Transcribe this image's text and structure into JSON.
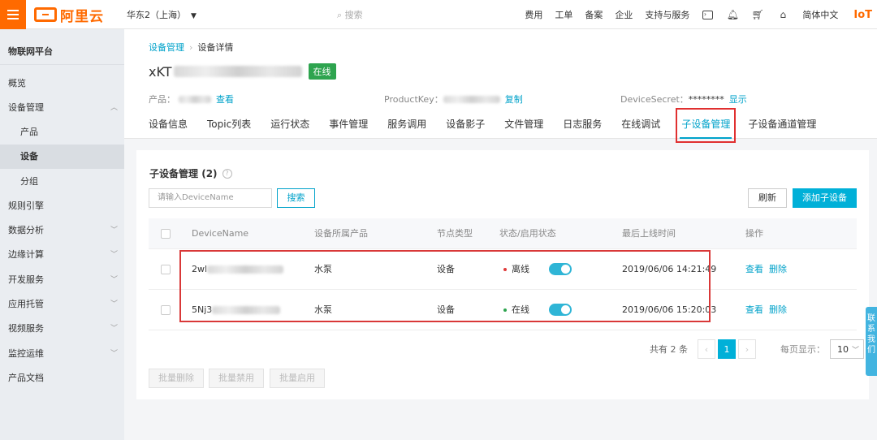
{
  "topbar": {
    "logo_text": "阿里云",
    "region": "华东2（上海）",
    "search_placeholder": "搜索",
    "links": [
      "费用",
      "工单",
      "备案",
      "企业",
      "支持与服务"
    ],
    "language": "简体中文",
    "iot_label": "IoT",
    "accent_color": "#ff6a00"
  },
  "sidebar": {
    "title": "物联网平台",
    "items": [
      {
        "label": "概览"
      },
      {
        "label": "设备管理"
      },
      {
        "label": "产品"
      },
      {
        "label": "设备"
      },
      {
        "label": "分组"
      },
      {
        "label": "规则引擎"
      },
      {
        "label": "数据分析"
      },
      {
        "label": "边缘计算"
      },
      {
        "label": "开发服务"
      },
      {
        "label": "应用托管"
      },
      {
        "label": "视频服务"
      },
      {
        "label": "监控运维"
      },
      {
        "label": "产品文档"
      }
    ]
  },
  "breadcrumb": {
    "parent": "设备管理",
    "current": "设备详情"
  },
  "device": {
    "name_prefix": "xKT",
    "status_badge": "在线",
    "product_label": "产品：",
    "product_link": "查看",
    "productkey_label": "ProductKey：",
    "productkey_link": "复制",
    "secret_label": "DeviceSecret：",
    "secret_value": "********",
    "secret_link": "显示"
  },
  "tabs": [
    "设备信息",
    "Topic列表",
    "运行状态",
    "事件管理",
    "服务调用",
    "设备影子",
    "文件管理",
    "日志服务",
    "在线调试",
    "子设备管理",
    "子设备通道管理"
  ],
  "card": {
    "title": "子设备管理",
    "count": "(2)",
    "search_placeholder": "请输入DeviceName",
    "search_button": "搜索",
    "refresh_button": "刷新",
    "add_button": "添加子设备"
  },
  "table": {
    "headers": [
      "DeviceName",
      "设备所属产品",
      "节点类型",
      "状态/启用状态",
      "最后上线时间",
      "操作"
    ],
    "rows": [
      {
        "name_prefix": "2wl",
        "product": "水泵",
        "node_type": "设备",
        "status": "离线",
        "status_color": "#e03a3a",
        "last_online": "2019/06/06 14:21:49",
        "view": "查看",
        "delete": "删除"
      },
      {
        "name_prefix": "5Nj3",
        "product": "水泵",
        "node_type": "设备",
        "status": "在线",
        "status_color": "#2ea44f",
        "last_online": "2019/06/06 15:20:03",
        "view": "查看",
        "delete": "删除"
      }
    ]
  },
  "pagination": {
    "total": "共有 2 条",
    "current_page": "1",
    "per_page_label": "每页显示：",
    "per_page_value": "10"
  },
  "bulk_actions": [
    "批量删除",
    "批量禁用",
    "批量启用"
  ],
  "float_tab": "联系我们"
}
